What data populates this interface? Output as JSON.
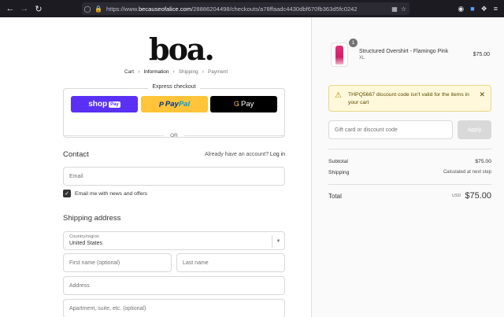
{
  "browser": {
    "url_prefix": "https://www.",
    "url_domain": "becauseofalice.com",
    "url_path": "/28886204498/checkouts/a78ffaadc4430dbf670fb363d5fc0242"
  },
  "header": {
    "logo": "boa."
  },
  "breadcrumb": {
    "items": [
      "Cart",
      "Information",
      "Shipping",
      "Payment"
    ]
  },
  "express_checkout": {
    "title": "Express checkout",
    "shop_label": "shop",
    "shop_pill": "Pay",
    "paypal_part1": "Pay",
    "paypal_part2": "Pal",
    "gpay_g": "G",
    "gpay_label": "Pay",
    "or_label": "OR"
  },
  "contact": {
    "title": "Contact",
    "account_prompt": "Already have an account?",
    "login_label": "Log in",
    "email_placeholder": "Email",
    "newsletter_label": "Email me with news and offers"
  },
  "shipping": {
    "title": "Shipping address",
    "country_label": "Country/region",
    "country_value": "United States",
    "first_name_placeholder": "First name (optional)",
    "last_name_placeholder": "Last name",
    "address_placeholder": "Address",
    "apartment_placeholder": "Apartment, suite, etc. (optional)"
  },
  "order": {
    "quantity": "1",
    "product_name": "Structured Overshirt - Flamingo Pink",
    "product_variant": "XL",
    "product_price": "$75.00",
    "alert_text": "THPQ5667 discount code isn't valid for the items in your cart",
    "discount_placeholder": "Gift card or discount code",
    "apply_label": "Apply",
    "subtotal_label": "Subtotal",
    "subtotal_value": "$75.00",
    "shipping_label": "Shipping",
    "shipping_value": "Calculated at next step",
    "total_label": "Total",
    "currency": "USD",
    "total_value": "$75.00"
  },
  "colors": {
    "shop_pay": "#5a31f4",
    "paypal": "#ffc439",
    "gpay": "#000000",
    "alert_bg": "#fff8db"
  }
}
